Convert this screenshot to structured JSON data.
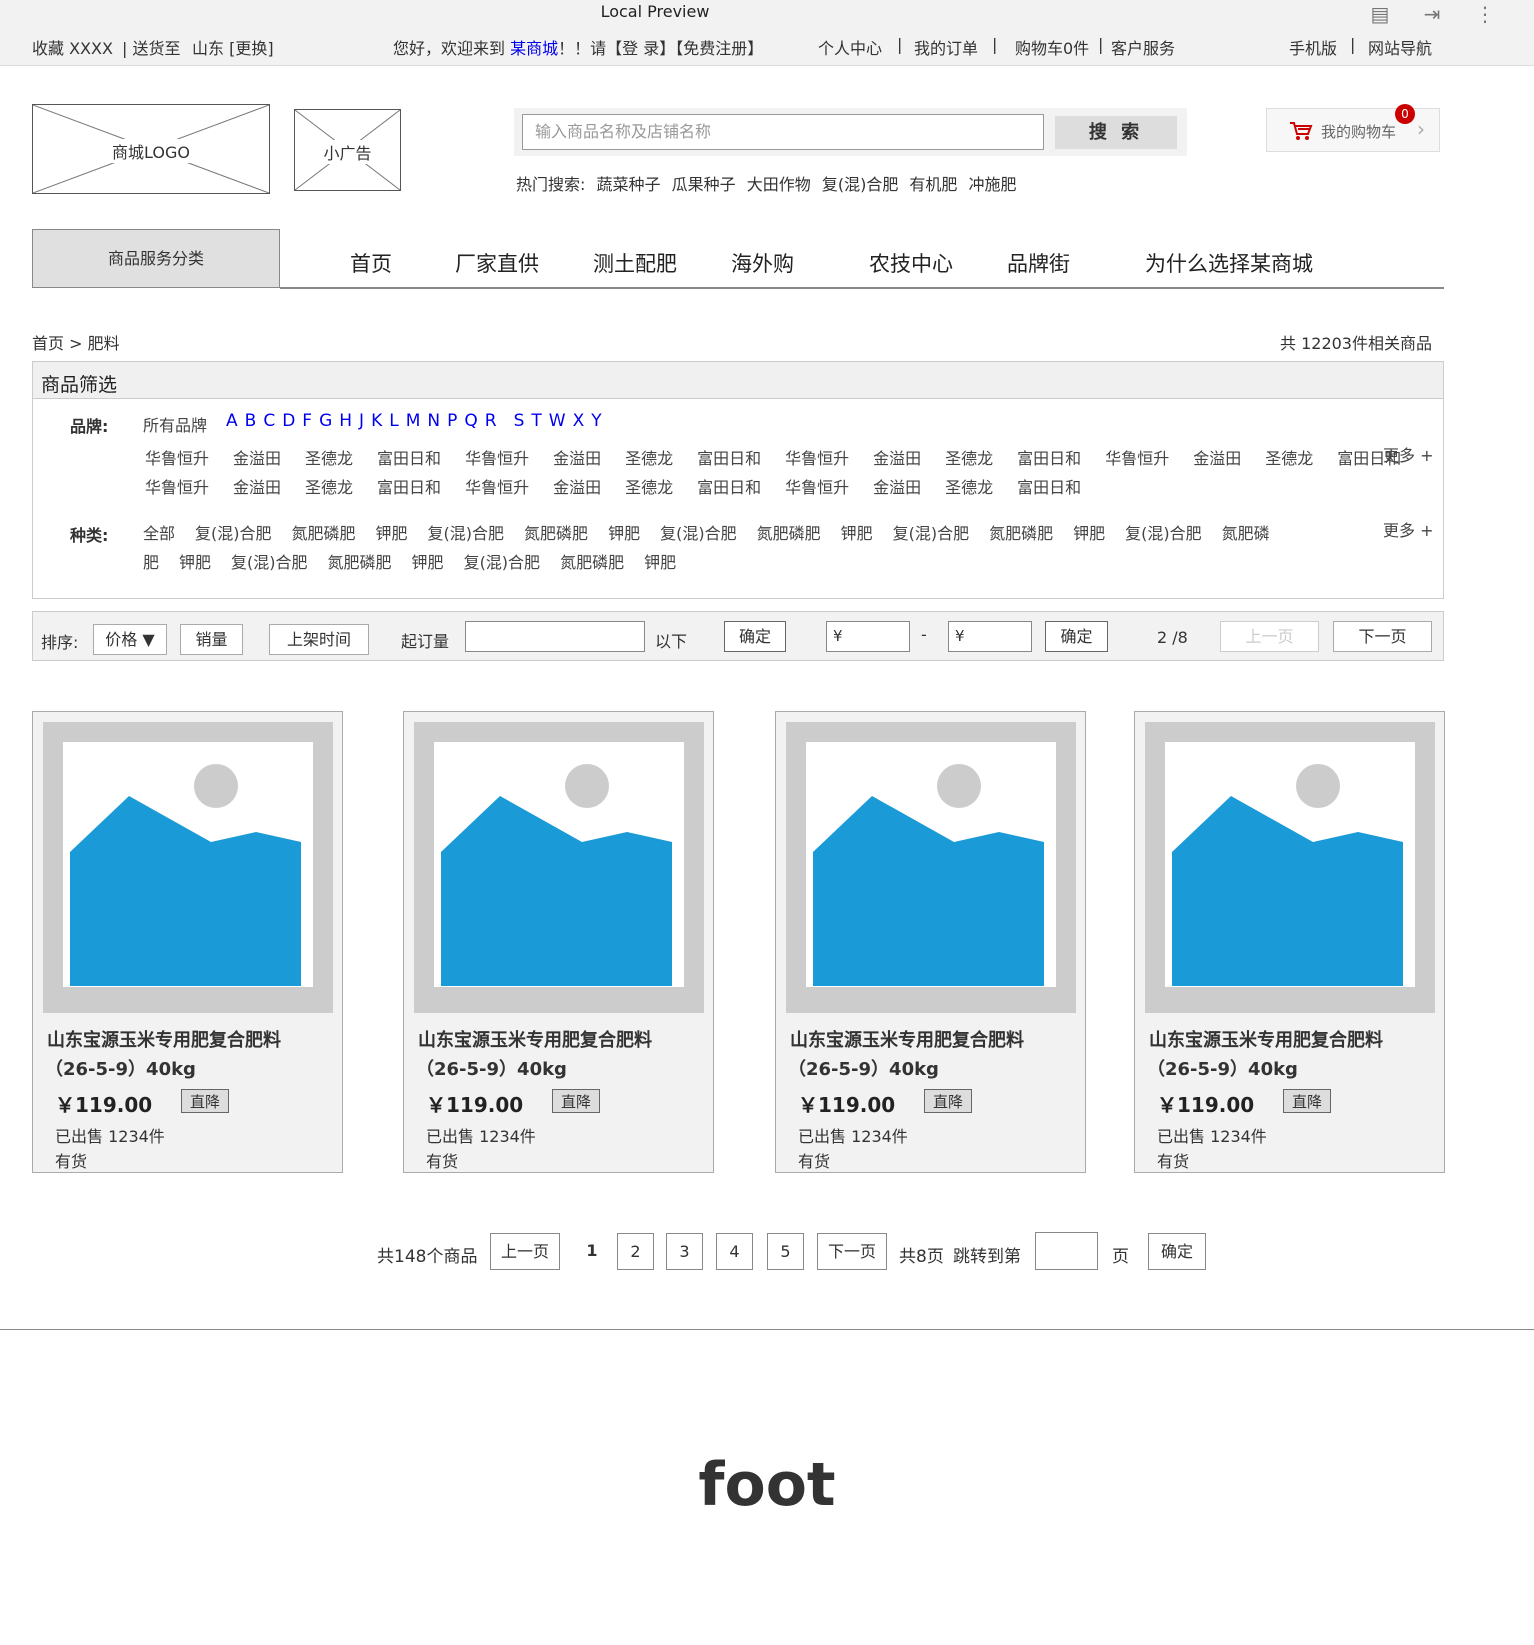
{
  "window": {
    "title": "Local Preview"
  },
  "topbar": {
    "favorite": "收藏 XXXX",
    "shipto": "| 送货至",
    "region": "山东 [更换]",
    "welcome_prefix": "您好，欢迎来到",
    "mall_name": "某商城",
    "welcome_suffix": "！！请【登 录】【免费注册】",
    "links": [
      "个人中心",
      "|",
      "我的订单",
      "|",
      "购物车0件",
      "|",
      "客户服务"
    ],
    "mobile": "手机版",
    "sep": "|",
    "sitenav": "网站导航"
  },
  "header": {
    "logo": "商城LOGO",
    "ad": "小广告",
    "search_placeholder": "输入商品名称及店铺名称",
    "search_button": "搜 索",
    "hot_label": "热门搜索:",
    "hot_terms": [
      "蔬菜种子",
      "瓜果种子",
      "大田作物",
      "复(混)合肥",
      "有机肥",
      "冲施肥"
    ],
    "cart_label": "我的购物车",
    "cart_count": "0"
  },
  "nav": {
    "category_button": "商品服务分类",
    "items": [
      "首页",
      "厂家直供",
      "测土配肥",
      "海外购",
      "农技中心",
      "品牌街",
      "为什么选择某商城"
    ]
  },
  "breadcrumb": "首页 > 肥料",
  "total_count": "共 12203件相关商品",
  "filter": {
    "heading": "商品筛选",
    "brand_label": "品牌:",
    "all_brands": "所有品牌",
    "letters": [
      "A",
      "B",
      "C",
      "D",
      "F",
      "G",
      "H",
      "J",
      "K",
      "L",
      "M",
      "N",
      "P",
      "Q",
      "R",
      "S",
      "T",
      "W",
      "X",
      "Y"
    ],
    "brand_row1": [
      "华鲁恒升",
      "金溢田",
      "圣德龙",
      "富田日和",
      "华鲁恒升",
      "金溢田",
      "圣德龙",
      "富田日和",
      "华鲁恒升",
      "金溢田",
      "圣德龙",
      "富田日和",
      "华鲁恒升",
      "金溢田",
      "圣德龙",
      "富田日和"
    ],
    "brand_row2": [
      "华鲁恒升",
      "金溢田",
      "圣德龙",
      "富田日和",
      "华鲁恒升",
      "金溢田",
      "圣德龙",
      "富田日和",
      "华鲁恒升",
      "金溢田",
      "圣德龙",
      "富田日和"
    ],
    "type_label": "种类:",
    "type_row1": [
      "全部",
      "复(混)合肥",
      "氮肥磷肥",
      "钾肥",
      "复(混)合肥",
      "氮肥磷肥",
      "钾肥",
      "复(混)合肥",
      "氮肥磷肥",
      "钾肥",
      "复(混)合肥",
      "氮肥磷肥",
      "钾肥",
      "复(混)合肥",
      "氮肥磷"
    ],
    "type_row2": [
      "肥",
      "钾肥",
      "复(混)合肥",
      "氮肥磷肥",
      "钾肥",
      "复(混)合肥",
      "氮肥磷肥",
      "钾肥"
    ],
    "more": "更多 +"
  },
  "sortbar": {
    "label": "排序:",
    "price": "价格 ▼",
    "sales": "销量",
    "time": "上架时间",
    "min_order": "起订量",
    "below": "以下",
    "confirm": "确定",
    "yen1": "¥",
    "dash": "-",
    "yen2": "¥",
    "page_info": "2 /8",
    "prev": "上一页",
    "next": "下一页"
  },
  "products": [
    {
      "title": "山东宝源玉米专用肥复合肥料",
      "spec": "（26-5-9）40kg",
      "price": "￥119.00",
      "tag": "直降",
      "sold": "已出售 1234件",
      "stock": "有货"
    },
    {
      "title": "山东宝源玉米专用肥复合肥料",
      "spec": "（26-5-9）40kg",
      "price": "￥119.00",
      "tag": "直降",
      "sold": "已出售 1234件",
      "stock": "有货"
    },
    {
      "title": "山东宝源玉米专用肥复合肥料",
      "spec": "（26-5-9）40kg",
      "price": "￥119.00",
      "tag": "直降",
      "sold": "已出售 1234件",
      "stock": "有货"
    },
    {
      "title": "山东宝源玉米专用肥复合肥料",
      "spec": "（26-5-9）40kg",
      "price": "￥119.00",
      "tag": "直降",
      "sold": "已出售 1234件",
      "stock": "有货"
    }
  ],
  "pager": {
    "total": "共148个商品",
    "prev": "上一页",
    "pages": [
      "1",
      "2",
      "3",
      "4",
      "5"
    ],
    "next": "下一页",
    "total_pages": "共8页",
    "jump": "跳转到第",
    "page_unit": "页",
    "confirm": "确定"
  },
  "footer": "foot",
  "colors": {
    "image_blue": "#1a9ad6",
    "image_frame": "#cccccc",
    "link_blue": "#0000ee",
    "badge_red": "#cc0000"
  }
}
